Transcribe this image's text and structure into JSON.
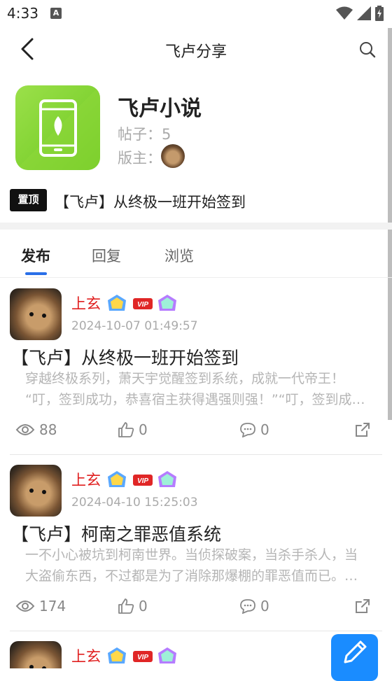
{
  "status_bar": {
    "time": "4:33",
    "notif_letter": "A"
  },
  "header": {
    "title": "飞卢分享"
  },
  "forum": {
    "name": "飞卢小说",
    "posts_label": "帖子：",
    "posts_count": "5",
    "moderator_label": "版主："
  },
  "pinned": {
    "badge": "置顶",
    "title": "【飞卢】从终极一班开始签到"
  },
  "tabs": [
    {
      "label": "发布",
      "active": true
    },
    {
      "label": "回复",
      "active": false
    },
    {
      "label": "浏览",
      "active": false
    }
  ],
  "posts": [
    {
      "username": "上玄",
      "badge_vip": "VIP",
      "date": "2024-10-07 01:49:57",
      "title": "【飞卢】从终极一班开始签到",
      "excerpt_line1": "穿越终极系列，萧天宇觉醒签到系统，成就一代帝王！",
      "excerpt_line2": "“叮，签到成功，恭喜宿主获得遇强则强！”“叮，签到成功，恭喜宿主获得…",
      "views": "88",
      "likes": "0",
      "comments": "0"
    },
    {
      "username": "上玄",
      "badge_vip": "VIP",
      "date": "2024-04-10 15:25:03",
      "title": "【飞卢】柯南之罪恶值系统",
      "excerpt_line1": "一不小心被坑到柯南世界。当侦探破案，当杀手杀人，当",
      "excerpt_line2": "大盗偷东西，不过都是为了消除那爆棚的罪恶值而已。…",
      "views": "174",
      "likes": "0",
      "comments": "0"
    },
    {
      "username": "上玄",
      "badge_vip": "VIP"
    }
  ],
  "colors": {
    "accent": "#2a6fe8",
    "username": "#e02020",
    "fab": "#1a8cff",
    "app_icon": "#7ed12e"
  },
  "icons": [
    "back-arrow-icon",
    "search-icon",
    "wifi-icon",
    "signal-icon",
    "battery-icon",
    "eye-icon",
    "thumbs-up-icon",
    "comment-icon",
    "share-icon",
    "edit-icon"
  ]
}
